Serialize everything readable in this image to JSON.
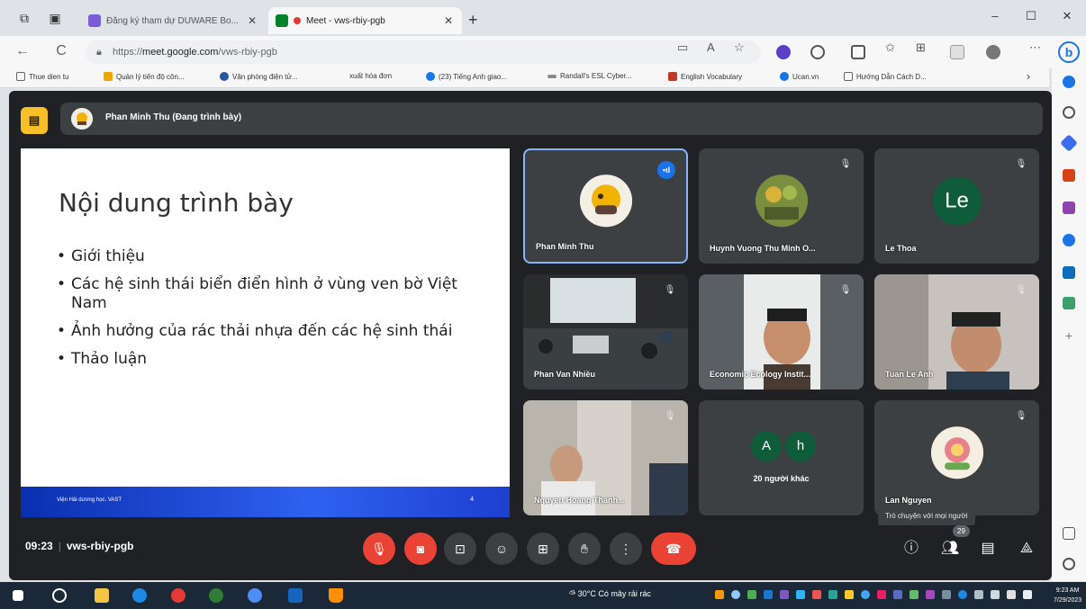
{
  "browser": {
    "tabs": [
      {
        "title": "Đăng ký tham dự DUWARE Bo...",
        "active": false
      },
      {
        "title": "Meet - vws-rbiy-pgb",
        "active": true
      }
    ],
    "new_tab": "+",
    "window_controls": {
      "minimize": "–",
      "maximize": "☐",
      "close": "✕"
    },
    "nav": {
      "back": "←",
      "reload": "C"
    },
    "url_prefix": "https://",
    "url_host": "meet.google.com",
    "url_path": "/vws-rbiy-pgb",
    "bookmarks": [
      "Thue dien tu",
      "Quản lý tiến độ côn...",
      "Văn phòng điện tử...",
      "xuất hóa đơn",
      "(23) Tiếng Anh giao...",
      "Randall's ESL Cyber...",
      "English Vocabulary",
      "Ucan.vn",
      "Hướng Dẫn Cách D..."
    ],
    "bookmarks_more": "›",
    "bing_label": "b"
  },
  "meet": {
    "presenter_label": "Phan Minh Thu (Đang trình bày)",
    "slide": {
      "title": "Nội dung trình bày",
      "bullets": [
        "Giới thiệu",
        "Các hệ sinh thái biển điển hình ở vùng ven bờ Việt Nam",
        "Ảnh hưởng của rác thải nhựa đến các hệ sinh thái",
        "Thảo luận"
      ],
      "footer_text": "Viện Hải dương học. VAST",
      "footer_page": "4"
    },
    "tiles": [
      {
        "name": "Phan Minh Thu"
      },
      {
        "name": "Huynh Vuong Thu Minh O..."
      },
      {
        "name": "Le Thoa",
        "initials": "Le"
      },
      {
        "name": "Phan Van Nhiều"
      },
      {
        "name": "Economic Ecology Instit..."
      },
      {
        "name": "Tuan Le Anh"
      },
      {
        "name": "Nguyen Hoang Thanh..."
      },
      {
        "name": "20 người khác",
        "initials": [
          "A",
          "h"
        ]
      },
      {
        "name": "Lan Nguyen"
      }
    ],
    "tooltip": "Trò chuyện với mọi người",
    "participant_count": "29",
    "time": "09:23",
    "meeting_code": "vws-rbiy-pgb"
  },
  "taskbar": {
    "weather": "30°C  Có mây rải rác",
    "clock_time": "9:23 AM",
    "clock_date": "7/29/2023"
  },
  "colors": {
    "meet_bg": "#202124",
    "tile_bg": "#3c4043",
    "hangup_red": "#ea4335",
    "accent_blue": "#1a73e8",
    "presenter_yellow": "#f6c026"
  }
}
